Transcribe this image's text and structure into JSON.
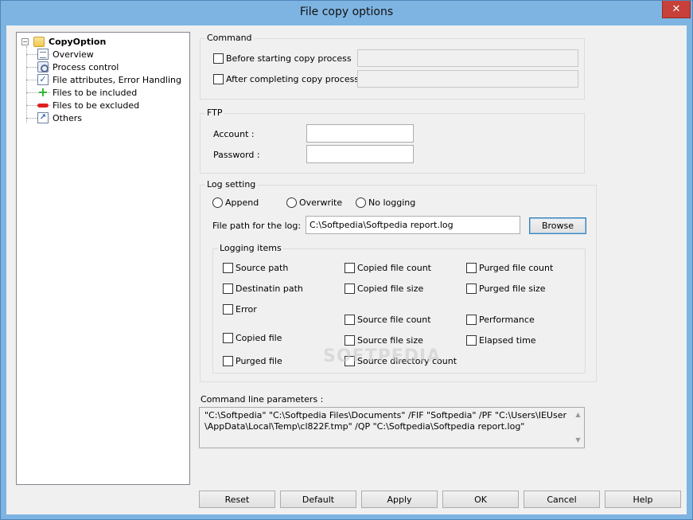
{
  "window": {
    "title": "File copy options",
    "close_glyph": "✕"
  },
  "tree": {
    "root": {
      "label": "CopyOption",
      "expander": "−",
      "icon": "folder-icon"
    },
    "items": [
      {
        "label": "Overview",
        "icon": "document-icon"
      },
      {
        "label": "Process control",
        "icon": "gear-icon"
      },
      {
        "label": "File attributes, Error Handling",
        "icon": "checklist-icon"
      },
      {
        "label": "Files to be included",
        "icon": "plus-icon"
      },
      {
        "label": "Files to be excluded",
        "icon": "minus-icon"
      },
      {
        "label": "Others",
        "icon": "shortcut-icon"
      }
    ]
  },
  "command": {
    "title": "Command",
    "before_label": "Before starting copy process",
    "before_checked": false,
    "after_label": "After completing copy process",
    "after_checked": false
  },
  "ftp": {
    "title": "FTP",
    "account_label": "Account :",
    "password_label": "Password :",
    "account_value": "",
    "password_value": ""
  },
  "log": {
    "title": "Log setting",
    "modes": [
      "Append",
      "Overwrite",
      "No logging"
    ],
    "path_label": "File path for the log:",
    "path_value": "C:\\Softpedia\\Softpedia report.log",
    "browse_label": "Browse",
    "items_title": "Logging items",
    "items": {
      "source_path": "Source path",
      "destination_path": "Destinatin path",
      "error": "Error",
      "copied_file": "Copied file",
      "purged_file": "Purged file",
      "copied_file_count": "Copied file count",
      "copied_file_size": "Copied file size",
      "source_file_count": "Source file count",
      "source_file_size": "Source file size",
      "source_directory_count": "Source directory count",
      "purged_file_count": "Purged file count",
      "purged_file_size": "Purged file size",
      "performance": "Performance",
      "elapsed_time": "Elapsed time"
    }
  },
  "cmdline": {
    "label": "Command line parameters :",
    "line1": "\"C:\\Softpedia\"  \"C:\\Softpedia Files\\Documents\" /FIF \"Softpedia\" /PF \"C:\\Users\\IEUser",
    "line2": "\\AppData\\Local\\Temp\\cl822F.tmp\" /QP \"C:\\Softpedia\\Softpedia report.log\""
  },
  "buttons": {
    "reset": "Reset",
    "default": "Default",
    "apply": "Apply",
    "ok": "OK",
    "cancel": "Cancel",
    "help": "Help"
  },
  "watermark": "SOFTPEDIA",
  "colors": {
    "titlebar": "#7eb4e2",
    "close": "#c7403a",
    "face": "#f0f0f0"
  }
}
